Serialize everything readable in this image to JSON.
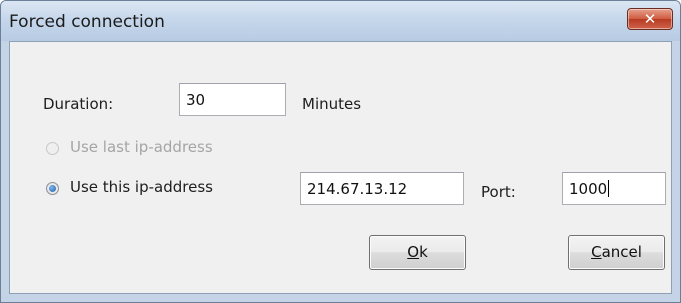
{
  "window": {
    "title": "Forced connection",
    "close_glyph": "✕"
  },
  "duration": {
    "label": "Duration:",
    "value": "30",
    "unit": "Minutes"
  },
  "options": {
    "last_ip_label": "Use last ip-address",
    "last_ip_checked": false,
    "last_ip_enabled": false,
    "this_ip_label": "Use this ip-address",
    "this_ip_checked": true,
    "ip_value": "214.67.13.12",
    "port_label": "Port:",
    "port_value": "1000"
  },
  "buttons": {
    "ok_mnemonic": "O",
    "ok_rest": "k",
    "cancel_mnemonic": "C",
    "cancel_rest": "ancel"
  },
  "colors": {
    "title_bar": "#c6d7eb",
    "close_button": "#c74b33",
    "dialog_bg": "#f0f0f0"
  }
}
